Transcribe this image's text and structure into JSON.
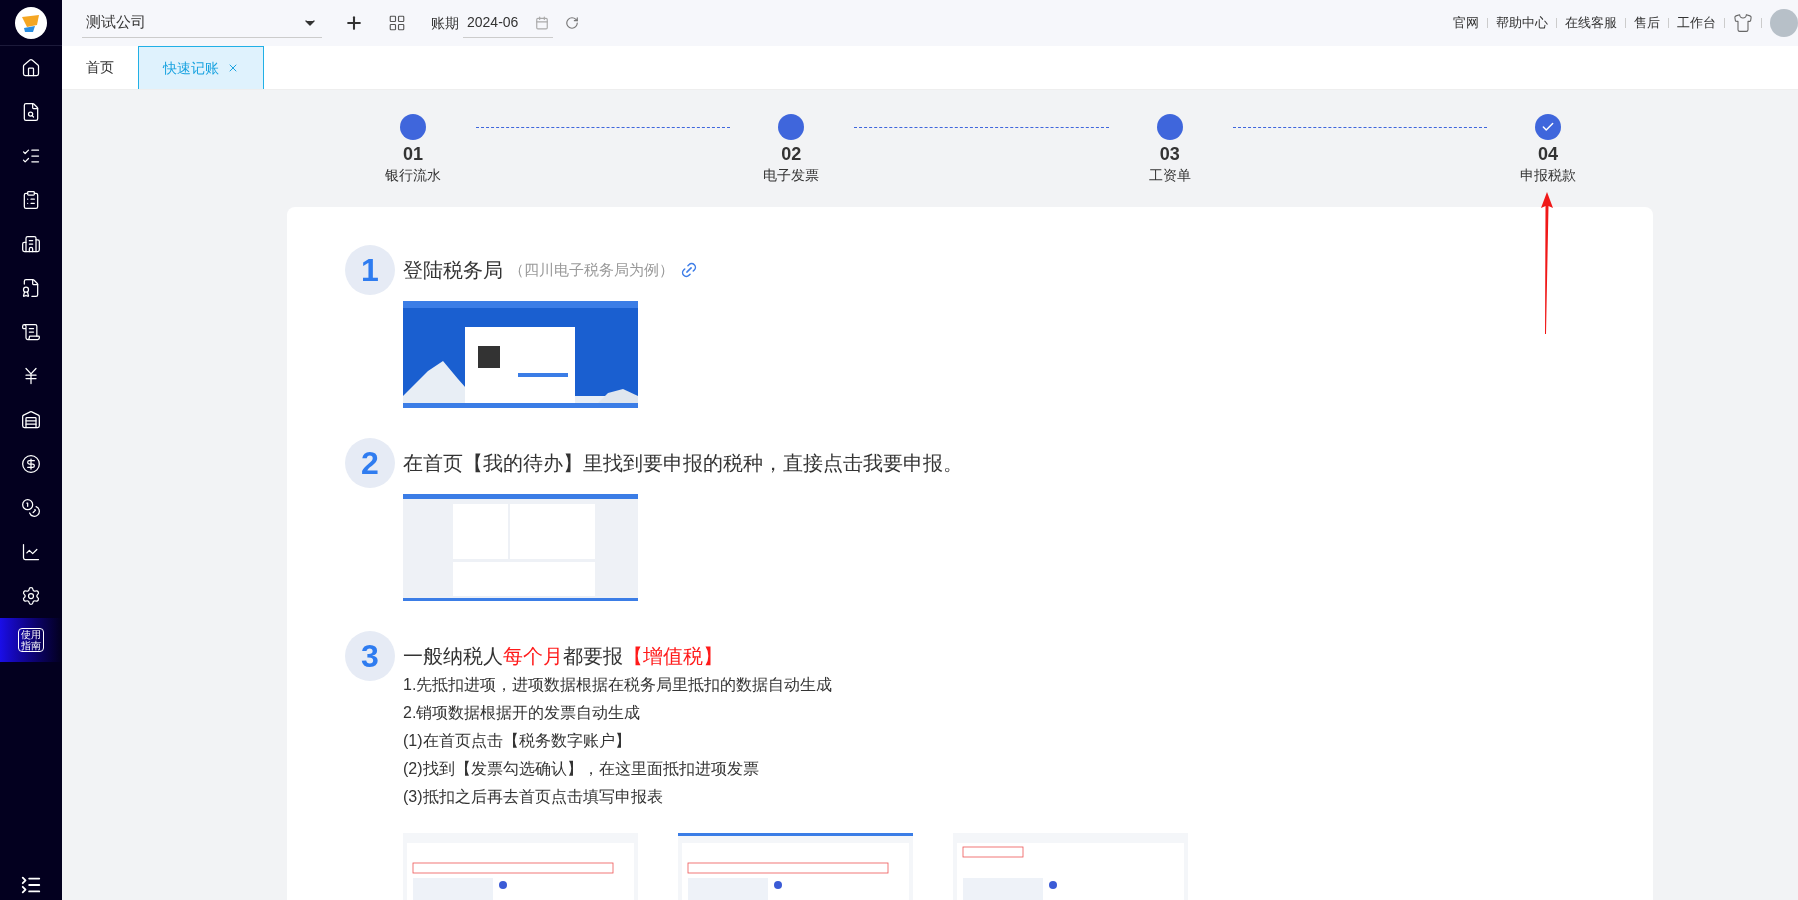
{
  "sidebar": {
    "items": [
      {
        "kind": "icon",
        "selected": false
      },
      {
        "kind": "icon",
        "selected": false
      },
      {
        "kind": "icon",
        "selected": false
      },
      {
        "kind": "icon",
        "selected": false
      },
      {
        "kind": "icon",
        "selected": false
      },
      {
        "kind": "icon",
        "selected": false
      },
      {
        "kind": "icon",
        "selected": false
      },
      {
        "kind": "icon",
        "selected": false
      },
      {
        "kind": "icon",
        "selected": false
      },
      {
        "kind": "icon",
        "selected": false
      },
      {
        "kind": "icon",
        "selected": false
      },
      {
        "kind": "icon",
        "selected": false
      },
      {
        "kind": "icon",
        "selected": false
      },
      {
        "kind": "text",
        "label": "使用指南",
        "selected": true
      }
    ]
  },
  "top_bar": {
    "company": {
      "value": "测试公司"
    },
    "period": {
      "label": "账期",
      "value": "2024-06"
    },
    "links": [
      "官网",
      "帮助中心",
      "在线客服",
      "售后",
      "工作台"
    ]
  },
  "tabs": [
    {
      "label": "首页",
      "selected": false,
      "closable": false
    },
    {
      "label": "快速记账",
      "selected": true,
      "closable": true
    }
  ],
  "progress_steps": [
    {
      "number": "01",
      "label": "银行流水",
      "done": false
    },
    {
      "number": "02",
      "label": "电子发票",
      "done": false
    },
    {
      "number": "03",
      "label": "工资单",
      "done": false
    },
    {
      "number": "04",
      "label": "申报税款",
      "done": true
    }
  ],
  "guide_steps": [
    {
      "number": "1",
      "title": [
        {
          "text": "登陆税务局",
          "highlight": false
        }
      ],
      "note": "（四川电子税务局为例）",
      "link": true,
      "screenshots": [
        {
          "kind": "login"
        }
      ]
    },
    {
      "number": "2",
      "title": [
        {
          "text": "在首页【我的待办】里找到要申报的税种，直接点击我要申报。",
          "highlight": false
        }
      ],
      "link": false,
      "screenshots": [
        {
          "kind": "todo"
        }
      ]
    },
    {
      "number": "3",
      "title": [
        {
          "text": "一般纳税人",
          "highlight": false
        },
        {
          "text": "每个月",
          "highlight": true
        },
        {
          "text": "都要报",
          "highlight": false
        },
        {
          "text": "【增值税】",
          "highlight": true
        }
      ],
      "link": false,
      "lines": [
        "1.先抵扣进项，进项数据根据在税务局里抵扣的数据自动生成",
        "2.销项数据根据开的发票自动生成",
        "(1)在首页点击【税务数字账户】",
        "(2)找到【发票勾选确认】，在这里面抵扣进项发票",
        "(3)抵扣之后再去首页点击填写申报表"
      ],
      "screenshots": [
        {
          "kind": "dashboard"
        },
        {
          "kind": "table"
        },
        {
          "kind": "form"
        }
      ]
    }
  ]
}
